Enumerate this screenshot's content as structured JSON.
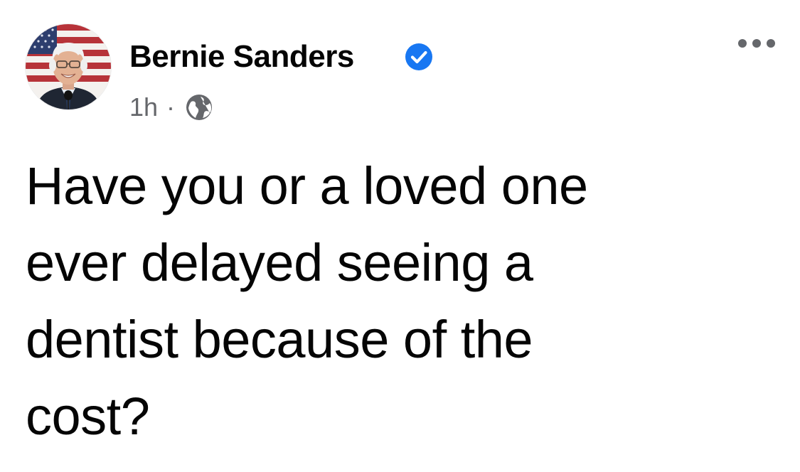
{
  "post": {
    "author": {
      "name": "Bernie Sanders",
      "verified": true,
      "avatar_icon": "profile-photo"
    },
    "timestamp": "1h",
    "separator": "·",
    "privacy_icon": "globe-icon",
    "menu_icon": "more-options-icon",
    "text_lines": [
      "Have you or a loved one",
      "ever delayed seeing a",
      "dentist because of the",
      "cost?"
    ]
  },
  "colors": {
    "text": "#050505",
    "secondary_text": "#65676b",
    "verified_blue": "#1877f2",
    "background": "#ffffff"
  }
}
